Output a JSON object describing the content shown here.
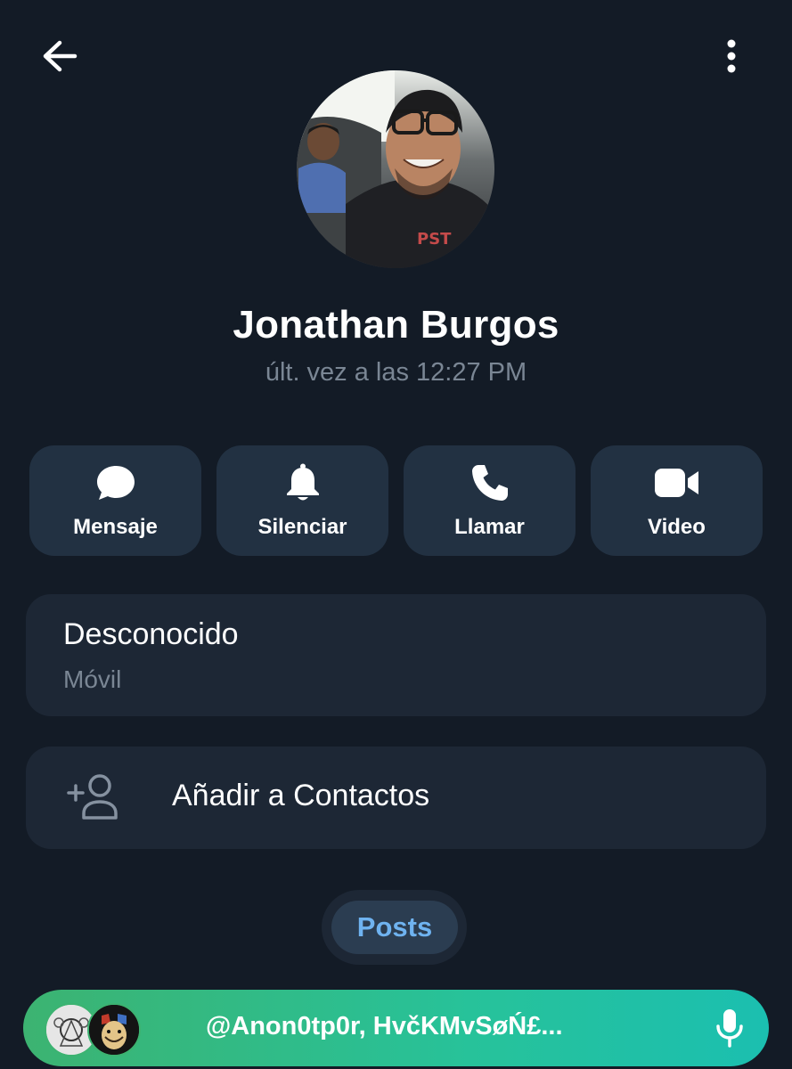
{
  "header": {
    "back_icon": "arrow-left-icon",
    "menu_icon": "more-vertical-icon"
  },
  "profile": {
    "name": "Jonathan Burgos",
    "last_seen": "últ. vez a las 12:27 PM"
  },
  "actions": [
    {
      "label": "Mensaje",
      "icon": "chat-bubble-icon"
    },
    {
      "label": "Silenciar",
      "icon": "bell-icon"
    },
    {
      "label": "Llamar",
      "icon": "phone-icon"
    },
    {
      "label": "Video",
      "icon": "video-camera-icon"
    }
  ],
  "phone": {
    "number": "Desconocido",
    "type": "Móvil"
  },
  "add_contact": {
    "label": "Añadir a Contactos",
    "icon": "add-person-icon"
  },
  "tabs": {
    "posts": "Posts"
  },
  "bottom_bar": {
    "text": "@Anon0tp0r, HvčKMvSøŃ£...",
    "icon": "microphone-icon"
  },
  "colors": {
    "background": "#131b26",
    "card": "#1d2735",
    "action_button": "#223142",
    "accent_blue": "#6fb3f0",
    "bar_gradient_start": "#3cb371",
    "bar_gradient_end": "#1bbfb0",
    "muted_text": "#7a8694"
  }
}
